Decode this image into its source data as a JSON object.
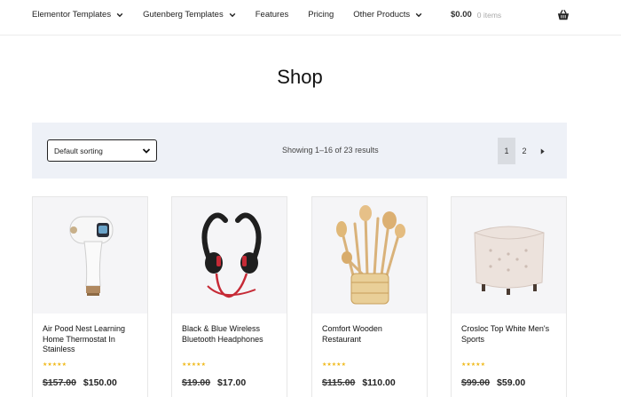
{
  "nav": {
    "items": [
      {
        "label": "Elementor Templates",
        "has_dropdown": true
      },
      {
        "label": "Gutenberg Templates",
        "has_dropdown": true
      },
      {
        "label": "Features",
        "has_dropdown": false
      },
      {
        "label": "Pricing",
        "has_dropdown": false
      },
      {
        "label": "Other Products",
        "has_dropdown": true
      }
    ]
  },
  "cart": {
    "amount": "$0.00",
    "items": "0 items",
    "icon": "basket-icon"
  },
  "page": {
    "title": "Shop"
  },
  "sorting": {
    "selected": "Default sorting"
  },
  "results": {
    "text": "Showing 1–16 of 23 results"
  },
  "pagination": {
    "pages": [
      "1",
      "2"
    ],
    "current": "1",
    "next_icon": "chevron-right-icon"
  },
  "products": [
    {
      "name": "Air Pood Nest Learning Home Thermostat In Stainless",
      "old_price": "$157.00",
      "price": "$150.00",
      "rating": 5
    },
    {
      "name": "Black & Blue Wireless Bluetooth Headphones",
      "old_price": "$19.00",
      "price": "$17.00",
      "rating": 5
    },
    {
      "name": "Comfort Wooden Restaurant",
      "old_price": "$115.00",
      "price": "$110.00",
      "rating": 5
    },
    {
      "name": "Crosloc Top White Men's Sports",
      "old_price": "$99.00",
      "price": "$59.00",
      "rating": 5
    }
  ],
  "colors": {
    "accent_bar": "#eef1f7",
    "star": "#f0b91a",
    "current_page_bg": "#d9dce1"
  }
}
